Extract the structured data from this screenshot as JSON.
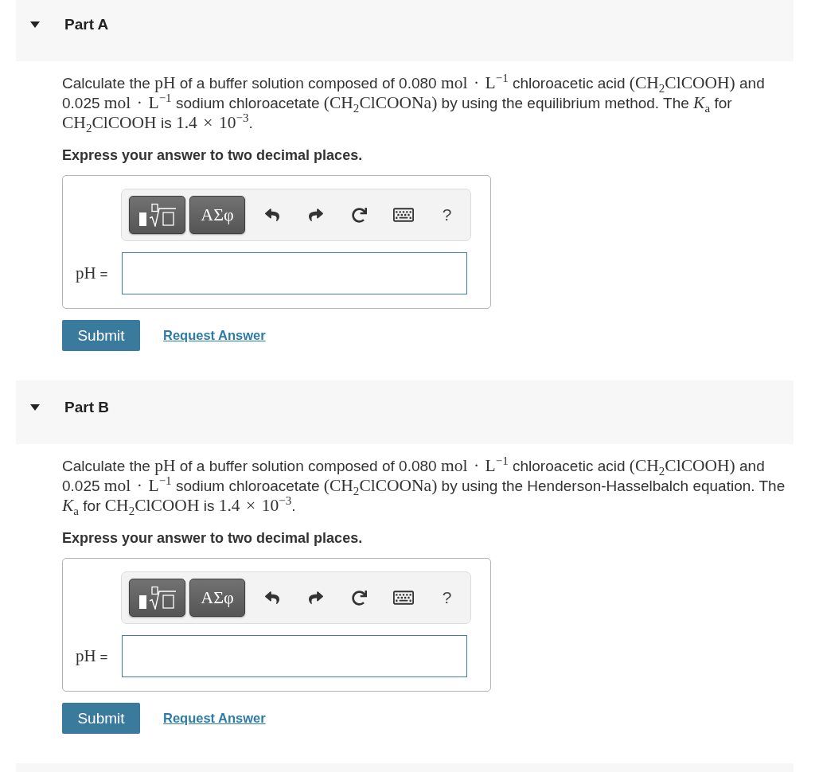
{
  "parts": [
    {
      "title": "Part A",
      "expanded": true,
      "question": [
        {
          "kind": "text",
          "text": "Calculate the "
        },
        {
          "kind": "math",
          "text": "pH"
        },
        {
          "kind": "text",
          "text": " of a buffer solution composed of 0.080 "
        },
        {
          "kind": "math",
          "text": "mol · L$^{−1}$"
        },
        {
          "kind": "text",
          "text": " chloroacetic acid "
        },
        {
          "kind": "math",
          "text": "(CH$_{2}$ClCOOH)"
        },
        {
          "kind": "text",
          "text": " and 0.025 "
        },
        {
          "kind": "math",
          "text": "mol · L$^{−1}$"
        },
        {
          "kind": "text",
          "text": " sodium chloroacetate "
        },
        {
          "kind": "math",
          "text": "(CH$_{2}$ClCOONa)"
        },
        {
          "kind": "text",
          "text": " by using the equilibrium method. The "
        },
        {
          "kind": "math",
          "text": "*K*$_{a}$"
        },
        {
          "kind": "text",
          "text": " for "
        },
        {
          "kind": "math",
          "text": "CH$_{2}$ClCOOH"
        },
        {
          "kind": "text",
          "text": " is "
        },
        {
          "kind": "math",
          "text": "1.4 × 10$^{−3}$"
        },
        {
          "kind": "text",
          "text": "."
        }
      ],
      "instruction": "Express your answer to two decimal places.",
      "toolbar": {
        "symbols_label": "ΑΣφ",
        "help_label": "?"
      },
      "answer_label": [
        {
          "kind": "math",
          "text": "pH"
        },
        {
          "kind": "text",
          "text": " ="
        }
      ],
      "submit": "Submit",
      "request_link": "Request Answer"
    },
    {
      "title": "Part B",
      "expanded": true,
      "question": [
        {
          "kind": "text",
          "text": "Calculate the "
        },
        {
          "kind": "math",
          "text": "pH"
        },
        {
          "kind": "text",
          "text": " of a buffer solution composed of 0.080 "
        },
        {
          "kind": "math",
          "text": "mol · L$^{−1}$"
        },
        {
          "kind": "text",
          "text": " chloroacetic acid "
        },
        {
          "kind": "math",
          "text": "(CH$_{2}$ClCOOH)"
        },
        {
          "kind": "text",
          "text": " and 0.025 "
        },
        {
          "kind": "math",
          "text": "mol · L$^{−1}$"
        },
        {
          "kind": "text",
          "text": " sodium chloroacetate "
        },
        {
          "kind": "math",
          "text": "(CH$_{2}$ClCOONa)"
        },
        {
          "kind": "text",
          "text": " by using the Henderson-Hasselbalch equation. The "
        },
        {
          "kind": "math",
          "text": "*K*$_{a}$"
        },
        {
          "kind": "text",
          "text": " for "
        },
        {
          "kind": "math",
          "text": "CH$_{2}$ClCOOH"
        },
        {
          "kind": "text",
          "text": " is "
        },
        {
          "kind": "math",
          "text": "1.4 × 10$^{−3}$"
        },
        {
          "kind": "text",
          "text": "."
        }
      ],
      "instruction": "Express your answer to two decimal places.",
      "toolbar": {
        "symbols_label": "ΑΣφ",
        "help_label": "?"
      },
      "answer_label": [
        {
          "kind": "math",
          "text": "pH"
        },
        {
          "kind": "text",
          "text": " ="
        }
      ],
      "submit": "Submit",
      "request_link": "Request Answer"
    }
  ]
}
